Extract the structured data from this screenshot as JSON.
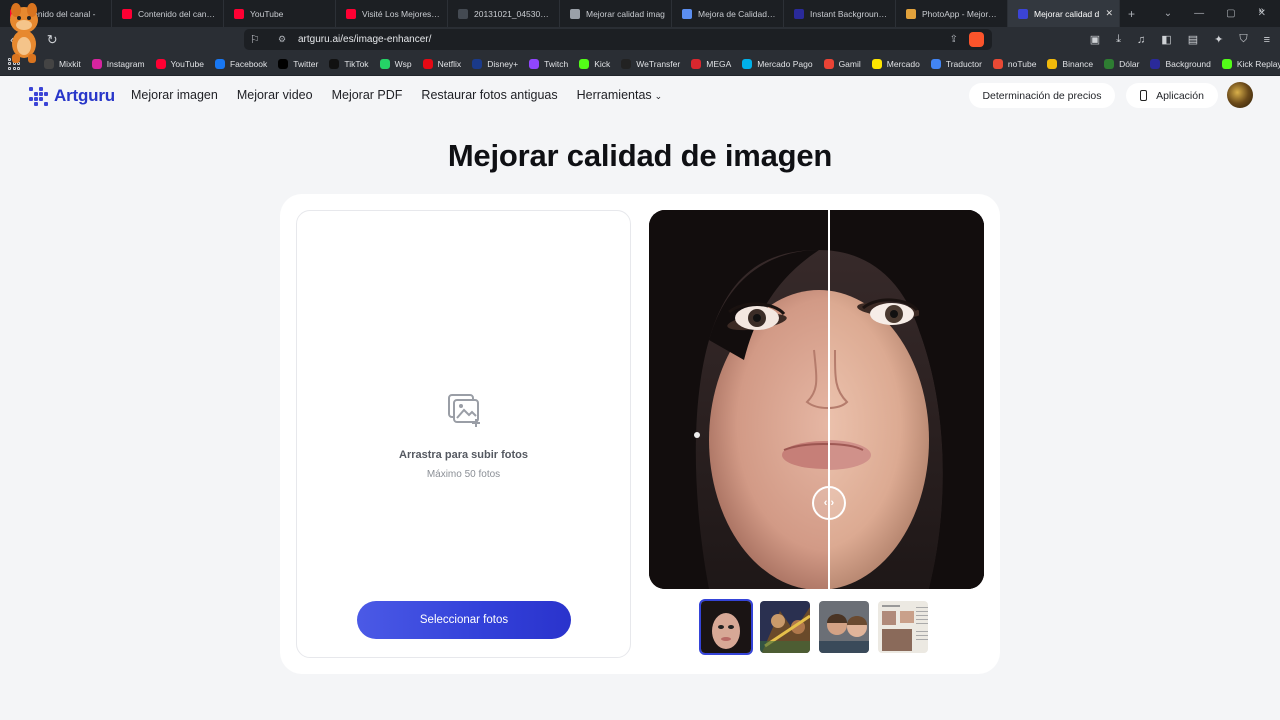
{
  "browser": {
    "tabs": [
      {
        "title": "ntenido del canal -",
        "favicon_color": "#ff0033"
      },
      {
        "title": "Contenido del canal -",
        "favicon_color": "#ff0033"
      },
      {
        "title": "YouTube",
        "favicon_color": "#ff0033"
      },
      {
        "title": "Visité Los Mejores Cib",
        "favicon_color": "#ff0033"
      },
      {
        "title": "20131021_045303_OL",
        "favicon_color": "#444a52"
      },
      {
        "title": "Mejorar calidad imag",
        "favicon_color": "#9aa0a8"
      },
      {
        "title": "Mejora de Calidad de",
        "favicon_color": "#5b8ef0"
      },
      {
        "title": "Instant Background R",
        "favicon_color": "#2a2a9a"
      },
      {
        "title": "PhotoApp - Mejorado",
        "favicon_color": "#e2a23c"
      },
      {
        "title": "Mejorar calidad d",
        "favicon_color": "#3b44d6",
        "active": true
      }
    ],
    "url": "artguru.ai/es/image-enhancer/",
    "bookmarks": [
      {
        "label": "Mixkit",
        "color": "#444"
      },
      {
        "label": "Instagram",
        "color": "#d6249f"
      },
      {
        "label": "YouTube",
        "color": "#ff0033"
      },
      {
        "label": "Facebook",
        "color": "#1877f2"
      },
      {
        "label": "Twitter",
        "color": "#000000"
      },
      {
        "label": "TikTok",
        "color": "#111111"
      },
      {
        "label": "Wsp",
        "color": "#25d366"
      },
      {
        "label": "Netflix",
        "color": "#e50914"
      },
      {
        "label": "Disney+",
        "color": "#1a3a8a"
      },
      {
        "label": "Twitch",
        "color": "#9146ff"
      },
      {
        "label": "Kick",
        "color": "#53fc18"
      },
      {
        "label": "WeTransfer",
        "color": "#222222"
      },
      {
        "label": "MEGA",
        "color": "#d9272e"
      },
      {
        "label": "Mercado Pago",
        "color": "#00b1ea"
      },
      {
        "label": "Gamil",
        "color": "#ea4335"
      },
      {
        "label": "Mercado",
        "color": "#ffe600"
      },
      {
        "label": "Traductor",
        "color": "#4285f4"
      },
      {
        "label": "noTube",
        "color": "#e94a35"
      },
      {
        "label": "Binance",
        "color": "#f0b90b"
      },
      {
        "label": "Dólar",
        "color": "#2e7d32"
      },
      {
        "label": "Background",
        "color": "#2a2a9a"
      },
      {
        "label": "Kick Replay",
        "color": "#53fc18"
      }
    ]
  },
  "header": {
    "logo": "Artguru",
    "nav": [
      "Mejorar imagen",
      "Mejorar video",
      "Mejorar PDF",
      "Restaurar fotos antiguas",
      "Herramientas"
    ],
    "pricing": "Determinación de precios",
    "app": "Aplicación"
  },
  "main": {
    "title": "Mejorar calidad de imagen",
    "upload": {
      "drag_text": "Arrastra para subir fotos",
      "max_text": "Máximo 50 fotos",
      "button": "Seleccionar fotos"
    },
    "compare_slider": 0.54,
    "thumbnails": [
      "woman-portrait",
      "fantasy-warriors",
      "couple-selfie",
      "old-newspaper"
    ],
    "selected_thumbnail": 0
  },
  "colors": {
    "brand": "#2836c9",
    "button_start": "#4b5ae6",
    "button_end": "#2a33cc"
  }
}
